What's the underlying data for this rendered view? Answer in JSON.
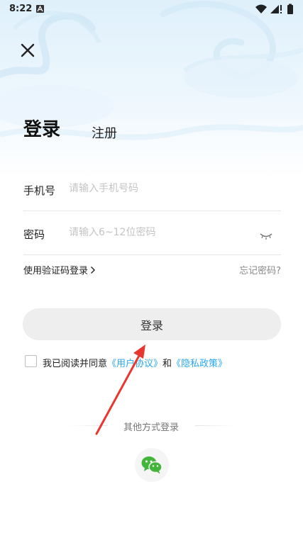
{
  "status_bar": {
    "time": "8:22",
    "icons": [
      "notification-a-icon",
      "wifi-icon",
      "signal-icon",
      "battery-icon"
    ]
  },
  "header": {
    "close_icon": "close-icon"
  },
  "tabs": {
    "login": "登录",
    "register": "注册"
  },
  "form": {
    "phone": {
      "label": "手机号",
      "value": "",
      "placeholder": "请输入手机号码"
    },
    "password": {
      "label": "密码",
      "value": "",
      "placeholder": "请输入6~12位密码",
      "toggle_icon": "eye-closed-icon"
    },
    "sms_login": "使用验证码登录",
    "forgot_password": "忘记密码?",
    "submit": "登录"
  },
  "agreement": {
    "checked": false,
    "prefix": "我已阅读并同意",
    "user_agreement": "《用户协议》",
    "and": "和",
    "privacy_policy": "《隐私政策》"
  },
  "other_login": {
    "label": "其他方式登录",
    "wechat_icon": "wechat-icon"
  },
  "colors": {
    "link": "#2aa7f0",
    "wechat": "#43b53b",
    "annotation_arrow": "#e8372f"
  }
}
